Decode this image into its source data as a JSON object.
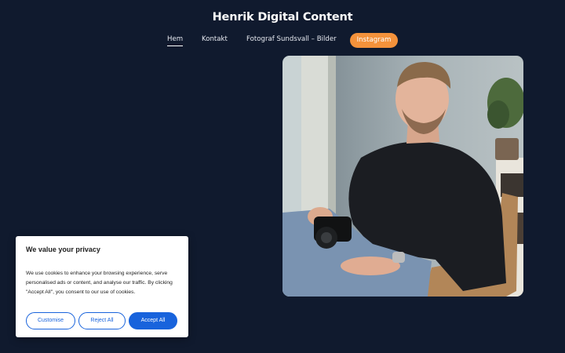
{
  "site": {
    "title": "Henrik Digital Content"
  },
  "nav": {
    "items": [
      {
        "label": "Hem",
        "active": true
      },
      {
        "label": "Kontakt",
        "active": false
      },
      {
        "label": "Fotograf Sundsvall – Bilder",
        "active": false
      }
    ],
    "instagram_label": "Instagram"
  },
  "cookie": {
    "title": "We value your privacy",
    "text": "We use cookies to enhance your browsing experience, serve personalised ads or content, and analyse our traffic. By clicking \"Accept All\", you consent to our use of cookies.",
    "customise_label": "Customise",
    "reject_label": "Reject All",
    "accept_label": "Accept All"
  },
  "colors": {
    "background": "#101a2e",
    "accent": "#f4923b",
    "consent_blue": "#1863dc"
  }
}
